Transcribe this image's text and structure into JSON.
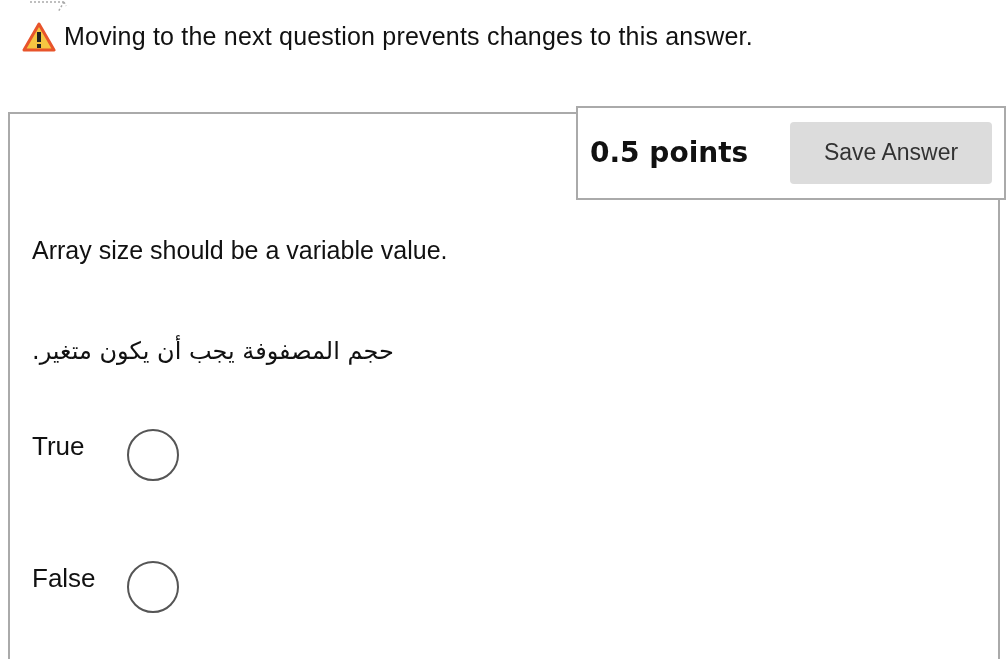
{
  "warning": "Moving to the next question prevents changes to this answer.",
  "question": {
    "points": "0.5 points",
    "save_button": "Save Answer",
    "text": "Array size should be a variable value.",
    "text_arabic": "حجم المصفوفة يجب أن يكون متغير.",
    "options": [
      {
        "label": "True",
        "selected": false
      },
      {
        "label": "False",
        "selected": false
      }
    ]
  }
}
